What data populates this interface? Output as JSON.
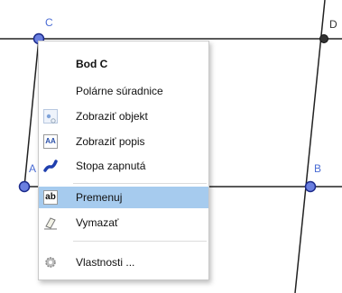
{
  "points": {
    "A": "A",
    "B": "B",
    "C": "C",
    "D": "D"
  },
  "menu": {
    "title": "Bod C",
    "items": [
      {
        "label": "Polárne súradnice"
      },
      {
        "label": "Zobraziť objekt",
        "icon": "show-object-icon"
      },
      {
        "label": "Zobraziť popis",
        "icon": "show-label-icon"
      },
      {
        "label": "Stopa zapnutá",
        "icon": "trace-icon"
      },
      {
        "label": "Premenuj",
        "icon": "rename-icon",
        "highlighted": true
      },
      {
        "label": "Vymazať",
        "icon": "eraser-icon"
      },
      {
        "label": "Vlastnosti ...",
        "icon": "gear-icon"
      }
    ],
    "icon_text": {
      "show_label": "AA",
      "rename": "ab"
    }
  },
  "colors": {
    "point_fill": "#6a7fe0",
    "point_stroke": "#1b2a8a",
    "line": "#222222",
    "highlight": "#a6cbee"
  }
}
